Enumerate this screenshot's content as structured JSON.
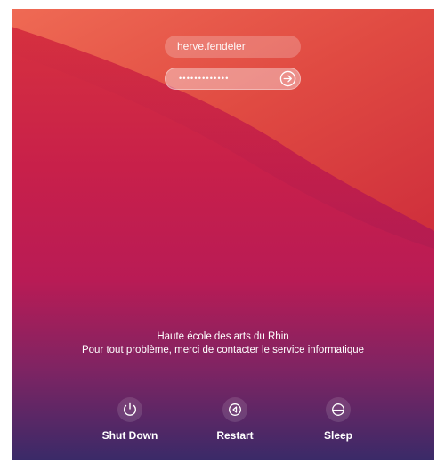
{
  "login": {
    "username": "herve.fendeler",
    "password_mask": "•••••••••••••"
  },
  "message": {
    "line1": "Haute école des arts du Rhin",
    "line2": "Pour tout problème, merci de contacter le service informatique"
  },
  "power_buttons": {
    "shutdown_label": "Shut Down",
    "restart_label": "Restart",
    "sleep_label": "Sleep"
  },
  "icons": {
    "submit": "arrow-right-circle-icon",
    "shutdown": "power-icon",
    "restart": "restart-icon",
    "sleep": "sleep-icon"
  },
  "colors": {
    "wallpaper_top": "#e0463e",
    "wallpaper_mid": "#c81e48",
    "wallpaper_bottom": "#3d2a6a"
  }
}
